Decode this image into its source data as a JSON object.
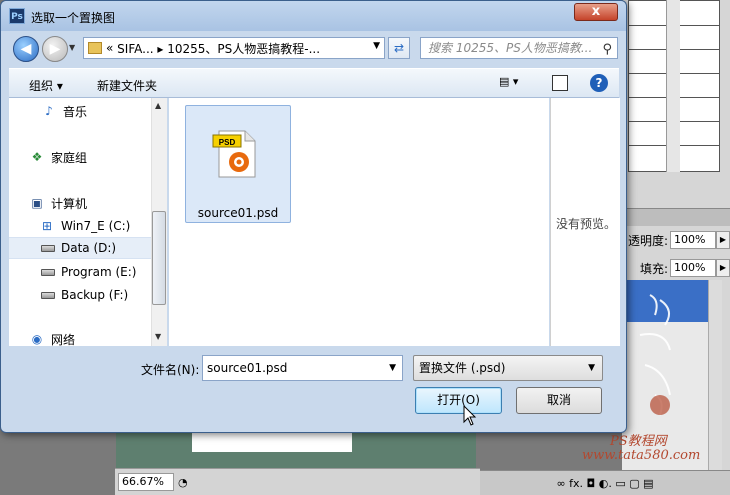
{
  "dialog": {
    "title": "选取一个置换图",
    "ps_icon": "Ps",
    "close_label": "x",
    "address_prefix": "«",
    "address_path": "SIFA... ▸ 10255、PS人物恶搞教程-...",
    "search_placeholder": "搜索 10255、PS人物恶搞教...",
    "toolbar": {
      "organize_label": "组织 ▾",
      "new_folder_label": "新建文件夹"
    },
    "nav_items": [
      {
        "label": "音乐",
        "icon": "music-icon"
      },
      {
        "label": "家庭组",
        "icon": "homegroup-icon"
      },
      {
        "label": "计算机",
        "icon": "computer-icon"
      },
      {
        "label": "Win7_E (C:)",
        "icon": "windows-drive-icon"
      },
      {
        "label": "Data (D:)",
        "icon": "drive-icon"
      },
      {
        "label": "Program (E:)",
        "icon": "drive-icon"
      },
      {
        "label": "Backup (F:)",
        "icon": "drive-icon"
      },
      {
        "label": "网络",
        "icon": "network-icon"
      }
    ],
    "file": {
      "name": "source01.psd",
      "badge": "PSD",
      "icon": "psd-file-icon"
    },
    "preview_text": "没有预览。",
    "filename_label": "文件名(N):",
    "filename_value": "source01.psd",
    "filetype_value": "置换文件 (.psd)",
    "open_label": "打开(O)",
    "cancel_label": "取消"
  },
  "photoshop": {
    "opacity_label": "透明度:",
    "opacity_value": "100%",
    "fill_label": "填充:",
    "fill_value": "100%",
    "zoom_value": "66.67%",
    "watermark_1": "PS教程网",
    "watermark_2": "www.tata580.com",
    "bottom_icons": "∞  fx.  ◘  ◐.  ▭  ▢  ▤"
  }
}
